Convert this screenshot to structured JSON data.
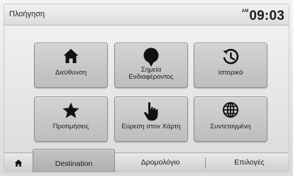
{
  "header": {
    "title": "Πλοήγηση",
    "clock_ampm": "AM",
    "clock_time": "09:03"
  },
  "tiles": [
    {
      "label": "Διεύθυνση",
      "icon": "home-icon"
    },
    {
      "label_line1": "Σημεία",
      "label_line2": "Ενδιαφέροντος",
      "icon": "poi-pin-icon"
    },
    {
      "label": "Ιστορικό",
      "icon": "history-icon"
    },
    {
      "label": "Προτιμήσεις",
      "icon": "star-icon"
    },
    {
      "label": "Εύρεση στον Χάρτη",
      "icon": "pointing-hand-icon"
    },
    {
      "label": "Συντεταγμένη",
      "icon": "globe-icon"
    }
  ],
  "tabs": {
    "home_icon": "home-icon",
    "destination": "Destination",
    "route": "Δρομολόγιο",
    "options": "Επιλογές"
  },
  "colors": {
    "tile": "#c8c8c8",
    "active_tab": "#b8b8b8",
    "icon": "#111111"
  }
}
